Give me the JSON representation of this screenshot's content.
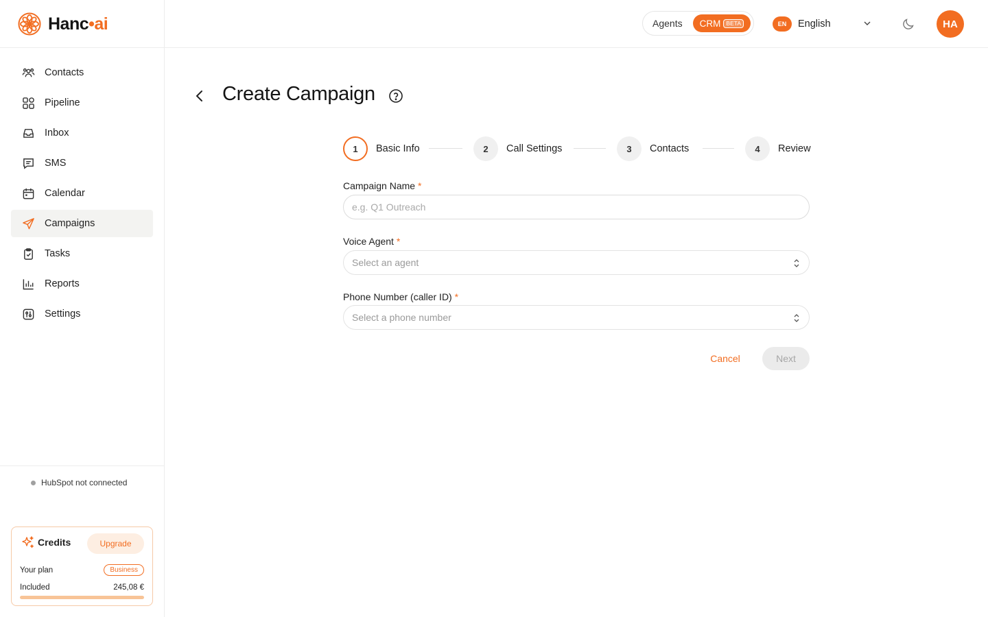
{
  "brand": {
    "name_part1": "Hanc",
    "name_dot": "•",
    "name_part2": "ai",
    "accent": "#f26d21"
  },
  "sidebar": {
    "items": [
      {
        "label": "Contacts",
        "icon": "contacts-icon"
      },
      {
        "label": "Pipeline",
        "icon": "pipeline-icon"
      },
      {
        "label": "Inbox",
        "icon": "inbox-icon"
      },
      {
        "label": "SMS",
        "icon": "sms-icon"
      },
      {
        "label": "Calendar",
        "icon": "calendar-icon"
      },
      {
        "label": "Campaigns",
        "icon": "send-icon",
        "active": true
      },
      {
        "label": "Tasks",
        "icon": "clipboard-icon"
      },
      {
        "label": "Reports",
        "icon": "bar-chart-icon"
      },
      {
        "label": "Settings",
        "icon": "sliders-icon"
      }
    ],
    "hubspot_status": "HubSpot not connected",
    "credits": {
      "title": "Credits",
      "upgrade_label": "Upgrade",
      "plan_label": "Your plan",
      "plan_value": "Business",
      "included_label": "Included",
      "included_value": "245,08 €",
      "progress_fraction": 1.0
    }
  },
  "topbar": {
    "mode_agents": "Agents",
    "mode_crm": "CRM",
    "beta_label": "BETA",
    "lang_code": "EN",
    "lang_name": "English",
    "avatar_initials": "HA"
  },
  "page": {
    "title": "Create Campaign",
    "steps": [
      {
        "number": "1",
        "label": "Basic Info",
        "active": true
      },
      {
        "number": "2",
        "label": "Call Settings"
      },
      {
        "number": "3",
        "label": "Contacts"
      },
      {
        "number": "4",
        "label": "Review"
      }
    ],
    "fields": {
      "campaign_name": {
        "label": "Campaign Name",
        "required": "*",
        "placeholder": "e.g. Q1 Outreach",
        "value": ""
      },
      "voice_agent": {
        "label": "Voice Agent",
        "required": "*",
        "placeholder": "Select an agent"
      },
      "phone_number": {
        "label": "Phone Number (caller ID)",
        "required": "*",
        "placeholder": "Select a phone number"
      }
    },
    "cancel_label": "Cancel",
    "next_label": "Next"
  }
}
